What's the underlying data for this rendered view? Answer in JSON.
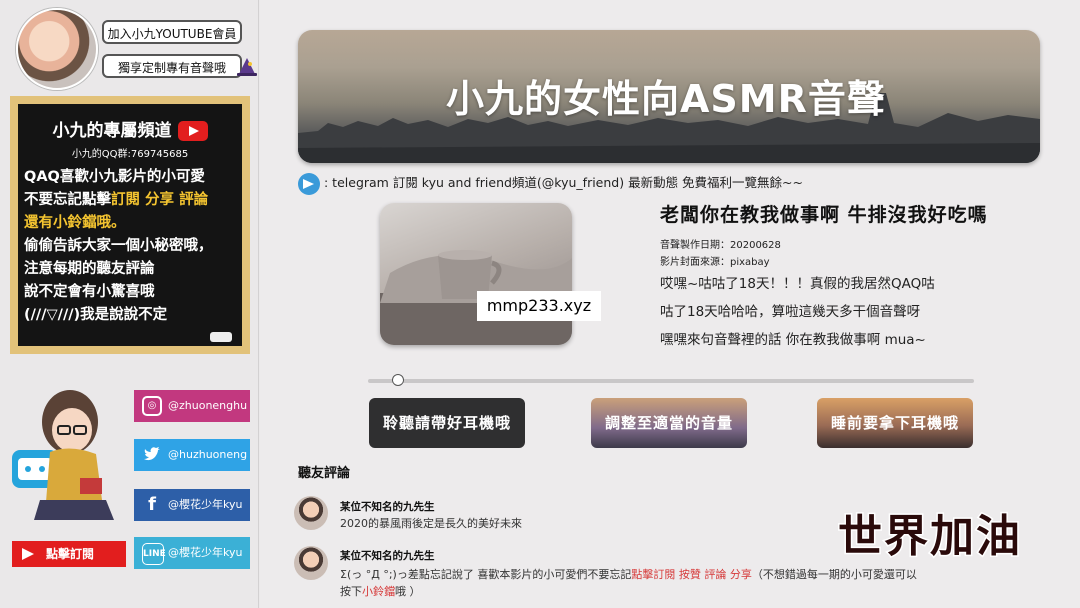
{
  "sidebar": {
    "join_label": "加入小九YOUTUBE會員",
    "exclusive_label": "獨享定制專有音聲哦",
    "board": {
      "title": "小九的專屬頻道",
      "qq": "小九的QQ群:769745685",
      "lines": [
        "QAQ喜歡小九影片的小可愛",
        "不要忘記點擊",
        "訂閱 分享 評論",
        "還有小鈴鐺哦。",
        "偷偷告訴大家一個小秘密哦，",
        "注意每期的聽友評論",
        "說不定會有小驚喜哦",
        "(///▽///)我是說說不定"
      ]
    },
    "socials": [
      {
        "label": "@zhuonenghu",
        "icon": "instagram-icon",
        "color": "#c2387f"
      },
      {
        "label": "@huzhuoneng",
        "icon": "twitter-icon",
        "color": "#2fa3e6"
      },
      {
        "label": "@櫻花少年kyu",
        "icon": "facebook-icon",
        "color": "#2d5fa8"
      },
      {
        "label": "@櫻花少年kyu",
        "icon": "line-icon",
        "color": "#3bb0d6"
      }
    ],
    "subscribe_label": "點擊訂閱"
  },
  "banner": {
    "title": "小九的女性向ASMR音聲"
  },
  "telegram": {
    "text": ": telegram 訂閱 kyu and friend頻道(@kyu_friend) 最新動態 免費福利一覽無餘~~"
  },
  "cover": {
    "watermark": "mmp233.xyz"
  },
  "song": {
    "title": "老闆你在教我做事啊 牛排沒我好吃嗎",
    "date": "音聲製作日期：20200628",
    "source": "影片封面來源：pixabay",
    "desc": [
      "哎嘿~咕咕了18天！！！真假的我居然QAQ咕",
      "咕了18天哈哈哈，算啦這幾天多干個音聲呀",
      "嘿嘿來句音聲裡的話 你在教我做事啊 mua~"
    ]
  },
  "player": {
    "progress": 0.05
  },
  "buttons": [
    {
      "label": "聆聽請帶好耳機哦"
    },
    {
      "label": "調整至適當的音量"
    },
    {
      "label": "睡前要拿下耳機哦"
    }
  ],
  "comments": {
    "section_title": "聽友評論",
    "items": [
      {
        "name": "某位不知名的九先生",
        "text": "2020的暴風雨後定是長久的美好未來"
      },
      {
        "name": "某位不知名的九先生",
        "text_a": "Σ(っ °Д °;)っ差點忘記說了 喜歡本影片的小可愛們不要忘記",
        "text_b": "點擊訂閱 按贊 評論 分享",
        "text_c": "（不想錯過每一期的小可愛還可以",
        "text_d": "按下",
        "text_e": "小鈴鐺",
        "text_f": "哦 ）"
      }
    ]
  },
  "stamp": "世界加油",
  "colors": {
    "accent_red": "#e21e1e",
    "board_frame": "#e2c27a",
    "highlight": "#f4c430"
  }
}
